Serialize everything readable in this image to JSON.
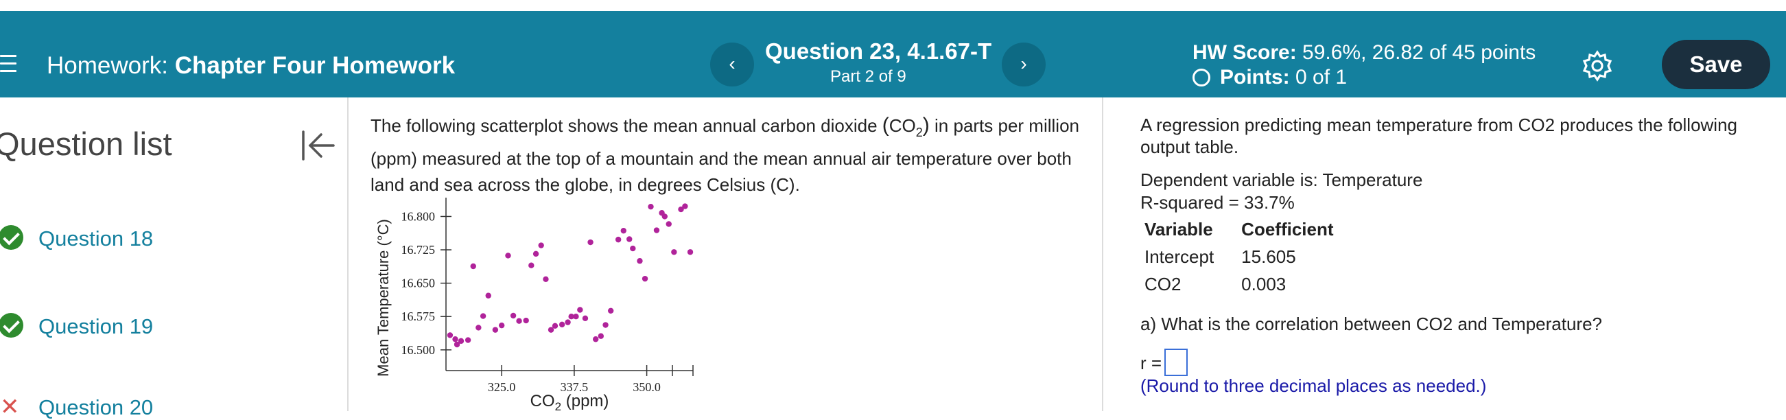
{
  "header": {
    "hw_prefix": "Homework:",
    "hw_name": "Chapter Four Homework",
    "question_title": "Question 23, 4.1.67-T",
    "question_part": "Part 2 of 9",
    "score_label": "HW Score:",
    "score_value": "59.6%, 26.82 of 45 points",
    "points_label": "Points:",
    "points_value": "0 of 1",
    "prev_symbol": "‹",
    "next_symbol": "›",
    "save_label": "Save",
    "icons": [
      "menu-icon",
      "chevron-left-icon",
      "chevron-right-icon",
      "empty-circle-icon",
      "gear-icon"
    ],
    "bar_color": "#14809e"
  },
  "sidebar": {
    "title": "Question list",
    "items": [
      {
        "label": "Question 18",
        "status": "correct"
      },
      {
        "label": "Question 19",
        "status": "correct"
      },
      {
        "label": "Question 20",
        "status": "incorrect"
      }
    ]
  },
  "question": {
    "prompt_1": "The following scatterplot shows the mean annual carbon dioxide ",
    "co2_main": "CO",
    "co2_sub": "2",
    "prompt_2": " in parts per million (ppm) measured at the top of a mountain and the mean annual air temperature over both land and sea across the globe, in degrees Celsius (C)."
  },
  "chart_data": {
    "type": "scatter",
    "title": "",
    "xlabel_main": "CO",
    "xlabel_sub": "2",
    "xlabel_unit": " (ppm)",
    "ylabel": "Mean Temperature (°C)",
    "x_ticks": [
      "325.0",
      "337.5",
      "350.0"
    ],
    "y_ticks": [
      "16.800",
      "16.725",
      "16.650",
      "16.575",
      "16.500"
    ],
    "xlim": [
      315.4,
      362.7
    ],
    "ylim": [
      16.475,
      16.83
    ],
    "point_color": "#b0239a",
    "points": [
      [
        316.1,
        16.533
      ],
      [
        317.0,
        16.524
      ],
      [
        317.3,
        16.512
      ],
      [
        318.0,
        16.52
      ],
      [
        319.2,
        16.522
      ],
      [
        320.1,
        16.688
      ],
      [
        321.0,
        16.55
      ],
      [
        321.8,
        16.576
      ],
      [
        322.7,
        16.622
      ],
      [
        323.9,
        16.545
      ],
      [
        325.0,
        16.555
      ],
      [
        326.1,
        16.712
      ],
      [
        327.0,
        16.577
      ],
      [
        328.0,
        16.565
      ],
      [
        329.2,
        16.566
      ],
      [
        330.1,
        16.69
      ],
      [
        330.9,
        16.716
      ],
      [
        331.8,
        16.735
      ],
      [
        332.6,
        16.659
      ],
      [
        333.5,
        16.545
      ],
      [
        334.2,
        16.554
      ],
      [
        335.4,
        16.557
      ],
      [
        336.4,
        16.562
      ],
      [
        337.0,
        16.575
      ],
      [
        337.8,
        16.575
      ],
      [
        338.5,
        16.59
      ],
      [
        339.4,
        16.571
      ],
      [
        340.3,
        16.742
      ],
      [
        341.2,
        16.524
      ],
      [
        342.1,
        16.531
      ],
      [
        342.9,
        16.556
      ],
      [
        343.8,
        16.588
      ],
      [
        345.1,
        16.748
      ],
      [
        346.0,
        16.768
      ],
      [
        347.0,
        16.749
      ],
      [
        347.6,
        16.728
      ],
      [
        348.8,
        16.7
      ],
      [
        349.7,
        16.66
      ],
      [
        350.7,
        16.822
      ],
      [
        351.7,
        16.769
      ],
      [
        352.6,
        16.808
      ],
      [
        353.1,
        16.8
      ],
      [
        353.8,
        16.783
      ],
      [
        354.7,
        16.72
      ],
      [
        355.9,
        16.816
      ],
      [
        356.6,
        16.823
      ],
      [
        357.5,
        16.72
      ]
    ]
  },
  "answer_panel": {
    "intro": "A regression predicting mean temperature from CO2 produces the following",
    "intro_2": "output table.",
    "dependent": "Dependent variable is: Temperature",
    "r_squared": "R-squared = 33.7%",
    "table_headers": [
      "Variable",
      "Coefficient"
    ],
    "table_rows": [
      {
        "variable": "Intercept",
        "coefficient": "15.605"
      },
      {
        "variable": "CO2",
        "coefficient": "0.003"
      }
    ],
    "question_a": "a) What is the correlation between CO2 and Temperature?",
    "r_label": "r =",
    "r_value": "",
    "round_note": "(Round to three decimal places as needed.)"
  }
}
